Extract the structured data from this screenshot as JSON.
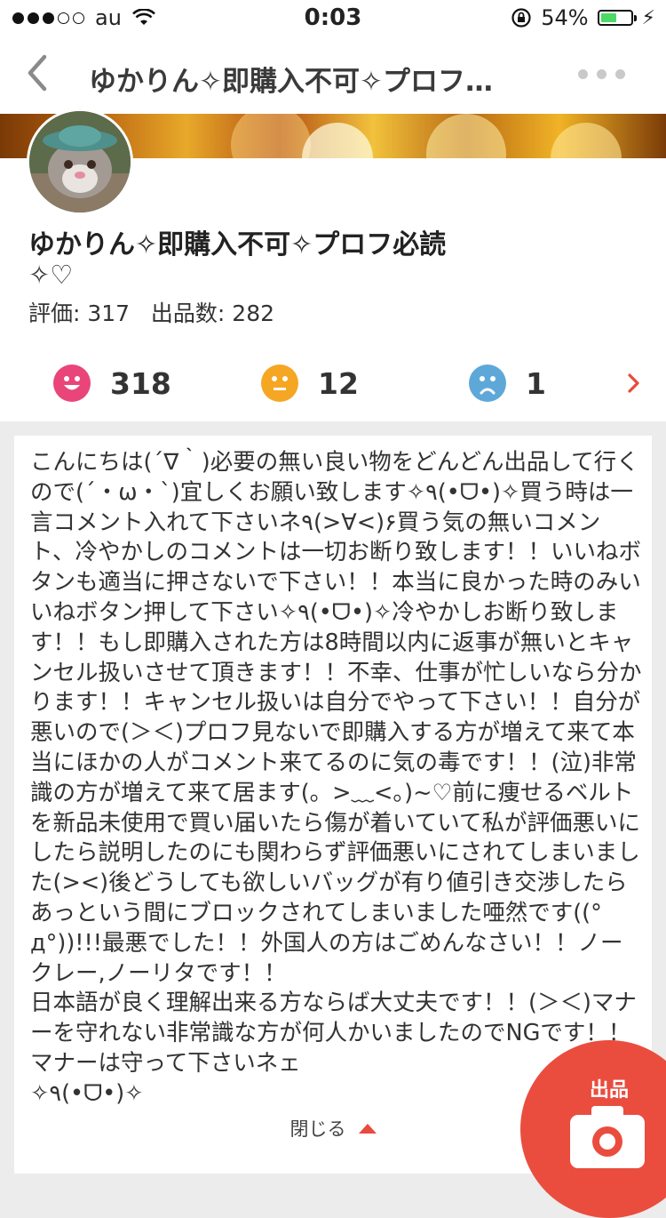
{
  "status_bar": {
    "carrier": "au",
    "time": "0:03",
    "battery_percent": "54%",
    "battery_level": 0.54,
    "signal_bars": 3
  },
  "nav": {
    "title": "ゆかりん✧即購入不可✧プロフ…",
    "back_icon": "chevron-left-icon",
    "more_icon": "ellipsis-icon"
  },
  "profile": {
    "name": "ゆかりん✧即購入不可✧プロフ必読",
    "name_suffix": "✧♡",
    "stats": "評価: 317   出品数: 282"
  },
  "ratings": {
    "good": "318",
    "normal": "12",
    "bad": "1",
    "colors": {
      "good": "#e9457a",
      "normal": "#f5a623",
      "bad": "#5ea8d9"
    }
  },
  "description": {
    "text": "こんにちは(´∇｀)必要の無い良い物をどんどん出品して行くので(´・ω・`)宜しくお願い致します✧٩(•ᗜ•)✧買う時は一言コメント入れて下さいネ٩(>∀<)۶買う気の無いコメント、冷やかしのコメントは一切お断り致します！！いいねボタンも適当に押さないで下さい！！本当に良かった時のみいいねボタン押して下さい✧٩(•ᗜ•)✧冷やかしお断り致します！！もし即購入された方は8時間以内に返事が無いとキャンセル扱いさせて頂きます！！不幸、仕事が忙しいなら分かります！！キャンセル扱いは自分でやって下さい！！自分が悪いので(＞＜)プロフ見ないで即購入する方が増えて来て本当にほかの人がコメント来てるのに気の毒です！！(泣)非常識の方が増えて来て居ます(。>﹏<。)~♡前に痩せるベルトを新品未使用で買い届いたら傷が着いていて私が評価悪いにしたら説明したのにも関わらず評価悪いにされてしまいました(><)後どうしても欲しいバッグが有り値引き交渉したらあっという間にブロックされてしまいました唖然です((°д°))!!!最悪でした！！外国人の方はごめんなさい！！ノークレー,ノーリタです！！\n日本語が良く理解出来る方ならば大丈夫です！！(＞＜)マナーを守れない非常識な方が何人かいましたのでNGです！！マナーは守って下さいネェ\n✧٩(•ᗜ•)✧",
    "close_label": "閉じる"
  },
  "sell_button": {
    "label": "出品",
    "icon": "camera-icon",
    "color": "#ea4d3e"
  }
}
